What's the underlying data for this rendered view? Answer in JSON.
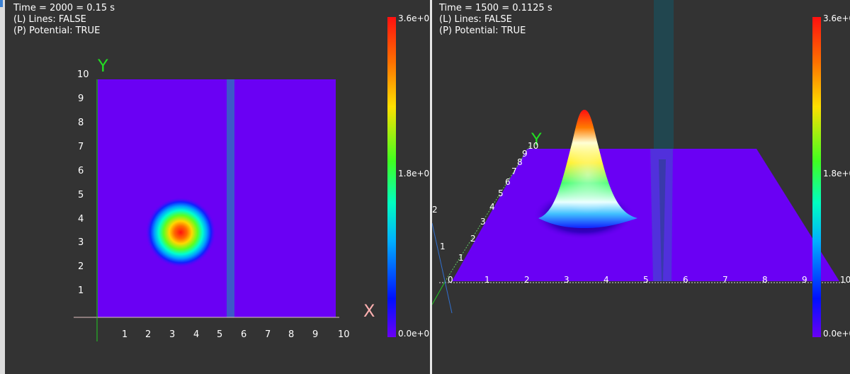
{
  "left_view": {
    "hud": {
      "time": "Time = 2000 = 0.15 s",
      "lines": "(L) Lines: FALSE",
      "potential": "(P) Potential: TRUE"
    },
    "axes": {
      "x_label": "X",
      "y_label": "Y",
      "x_ticks": [
        "1",
        "2",
        "3",
        "4",
        "5",
        "6",
        "7",
        "8",
        "9",
        "10"
      ],
      "y_ticks": [
        "1",
        "2",
        "3",
        "4",
        "5",
        "6",
        "7",
        "8",
        "9",
        "10"
      ]
    },
    "colorbar": {
      "max": "3.6e+0",
      "mid": "1.8e+0",
      "min": "0.0e+0"
    }
  },
  "right_view": {
    "hud": {
      "time": "Time = 1500 = 0.1125 s",
      "lines": "(L) Lines: FALSE",
      "potential": "(P) Potential: TRUE"
    },
    "axes": {
      "y_label": "Y",
      "x_ticks": [
        "0",
        "1",
        "2",
        "3",
        "4",
        "5",
        "6",
        "7",
        "8",
        "9",
        "10"
      ],
      "y_ticks": [
        "1",
        "2",
        "3",
        "4",
        "5",
        "6",
        "7",
        "8",
        "9",
        "10"
      ],
      "z_ticks": [
        "1",
        "2"
      ]
    },
    "colorbar": {
      "max": "3.6e+0",
      "mid": "1.8e+0",
      "min": "0.0e+0"
    }
  },
  "colors": {
    "background": "#333333",
    "plane": "#6a00f4",
    "potential_barrier": "#3d58c8",
    "x_axis_label": "#ffb0b0",
    "y_axis_label": "#22dd22"
  }
}
